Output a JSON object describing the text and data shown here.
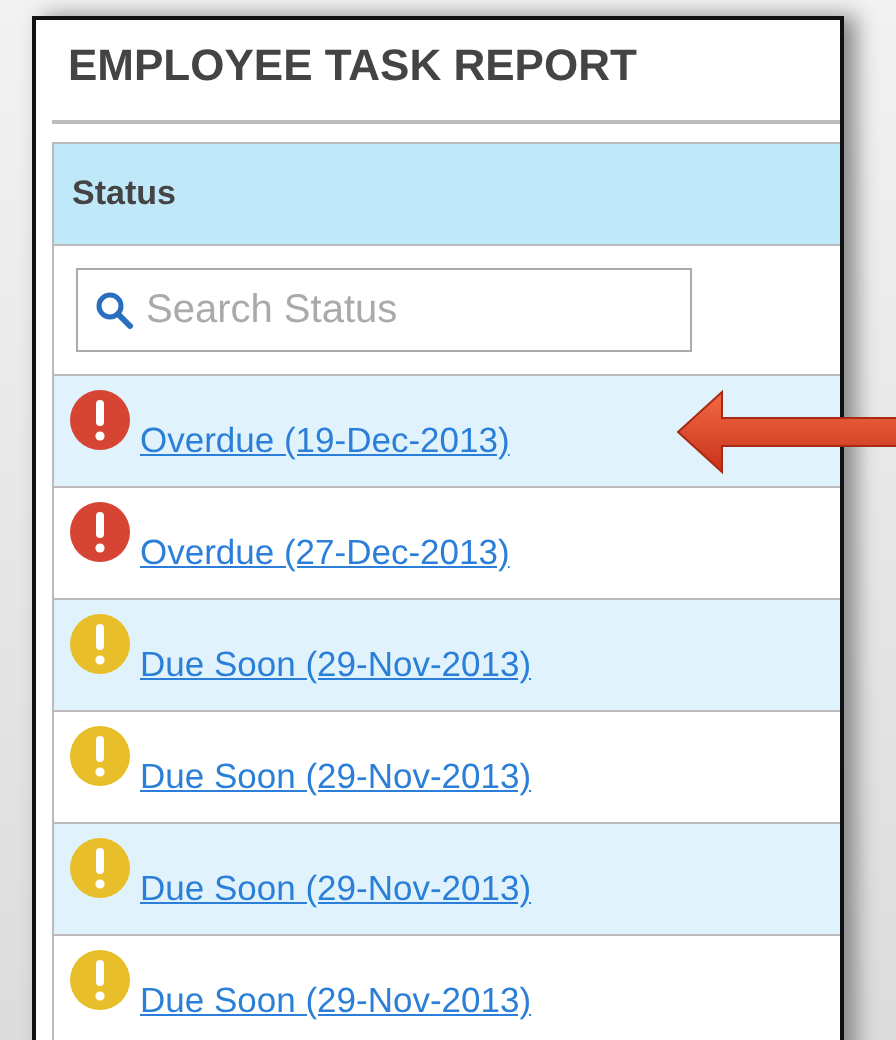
{
  "window": {
    "title": "EMPLOYEE TASK REPORT"
  },
  "table": {
    "columns": [
      "Status"
    ],
    "search": {
      "placeholder": "Search Status"
    },
    "rows": [
      {
        "kind": "overdue",
        "label": "Overdue (19-Dec-2013)",
        "highlighted": true
      },
      {
        "kind": "overdue",
        "label": "Overdue (27-Dec-2013)",
        "highlighted": false
      },
      {
        "kind": "due_soon",
        "label": "Due Soon (29-Nov-2013)",
        "highlighted": false
      },
      {
        "kind": "due_soon",
        "label": "Due Soon (29-Nov-2013)",
        "highlighted": false
      },
      {
        "kind": "due_soon",
        "label": "Due Soon (29-Nov-2013)",
        "highlighted": false
      },
      {
        "kind": "due_soon",
        "label": "Due Soon (29-Nov-2013)",
        "highlighted": false
      }
    ]
  }
}
